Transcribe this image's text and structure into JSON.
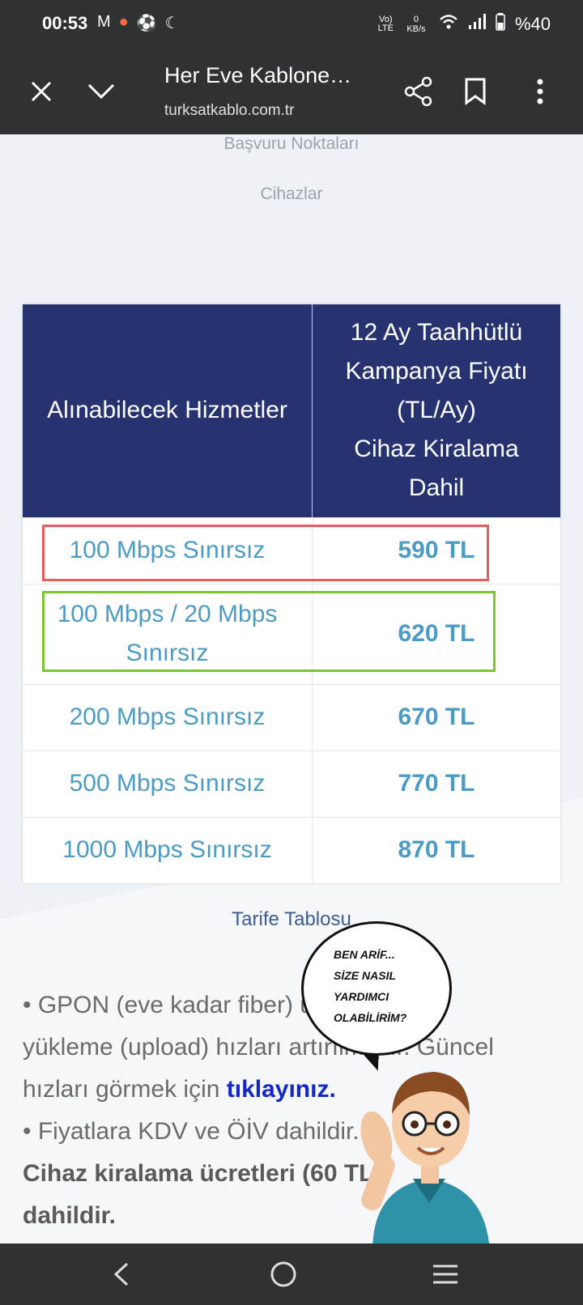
{
  "status_bar": {
    "time": "00:53",
    "battery": "%40",
    "net_speed": "0 KB/s"
  },
  "toolbar": {
    "title": "Her Eve Kablone…",
    "url": "turksatkablo.com.tr"
  },
  "nav_links": [
    "Başvuru Noktaları",
    "Cihazlar"
  ],
  "table": {
    "header_col1": "Alınabilecek Hizmetler",
    "header_col2_lines": [
      "12 Ay Taahhütlü",
      "Kampanya Fiyatı",
      "(TL/Ay)",
      "Cihaz Kiralama",
      "Dahil"
    ],
    "rows": [
      {
        "service": "100 Mbps Sınırsız",
        "price": "590 TL"
      },
      {
        "service": "100 Mbps / 20 Mbps Sınırsız",
        "price": "620 TL"
      },
      {
        "service": "200 Mbps Sınırsız",
        "price": "670 TL"
      },
      {
        "service": "500 Mbps Sınırsız",
        "price": "770 TL"
      },
      {
        "service": "1000 Mbps Sınırsız",
        "price": "870 TL"
      }
    ]
  },
  "caption": "Tarife Tablosu",
  "body": {
    "line1": "• GPON (eve kadar fiber)",
    "line1_tail": "ü",
    "line2": "yükleme (upload) hızları artırılmıştır. Güncel",
    "line3_prefix": "hızları görmek için ",
    "line3_link": "tıklayınız.",
    "line4": "• Fiyatlara KDV ve ÖİV dahildir.",
    "line5_bold": "Cihaz kiralama ücretleri (60 TL",
    "line6_bold": "dahildir."
  },
  "chatbot": {
    "bubble_lines": [
      "BEN ARİF...",
      "SİZE NASIL",
      "YARDIMCI",
      "OLABİLİRİM?"
    ]
  },
  "colors": {
    "header_bg": "#263370",
    "accent_blue": "#4b9bc5",
    "link_blue": "#1427c9",
    "highlight_red": "#e85c5c",
    "highlight_green": "#7cc62f"
  }
}
